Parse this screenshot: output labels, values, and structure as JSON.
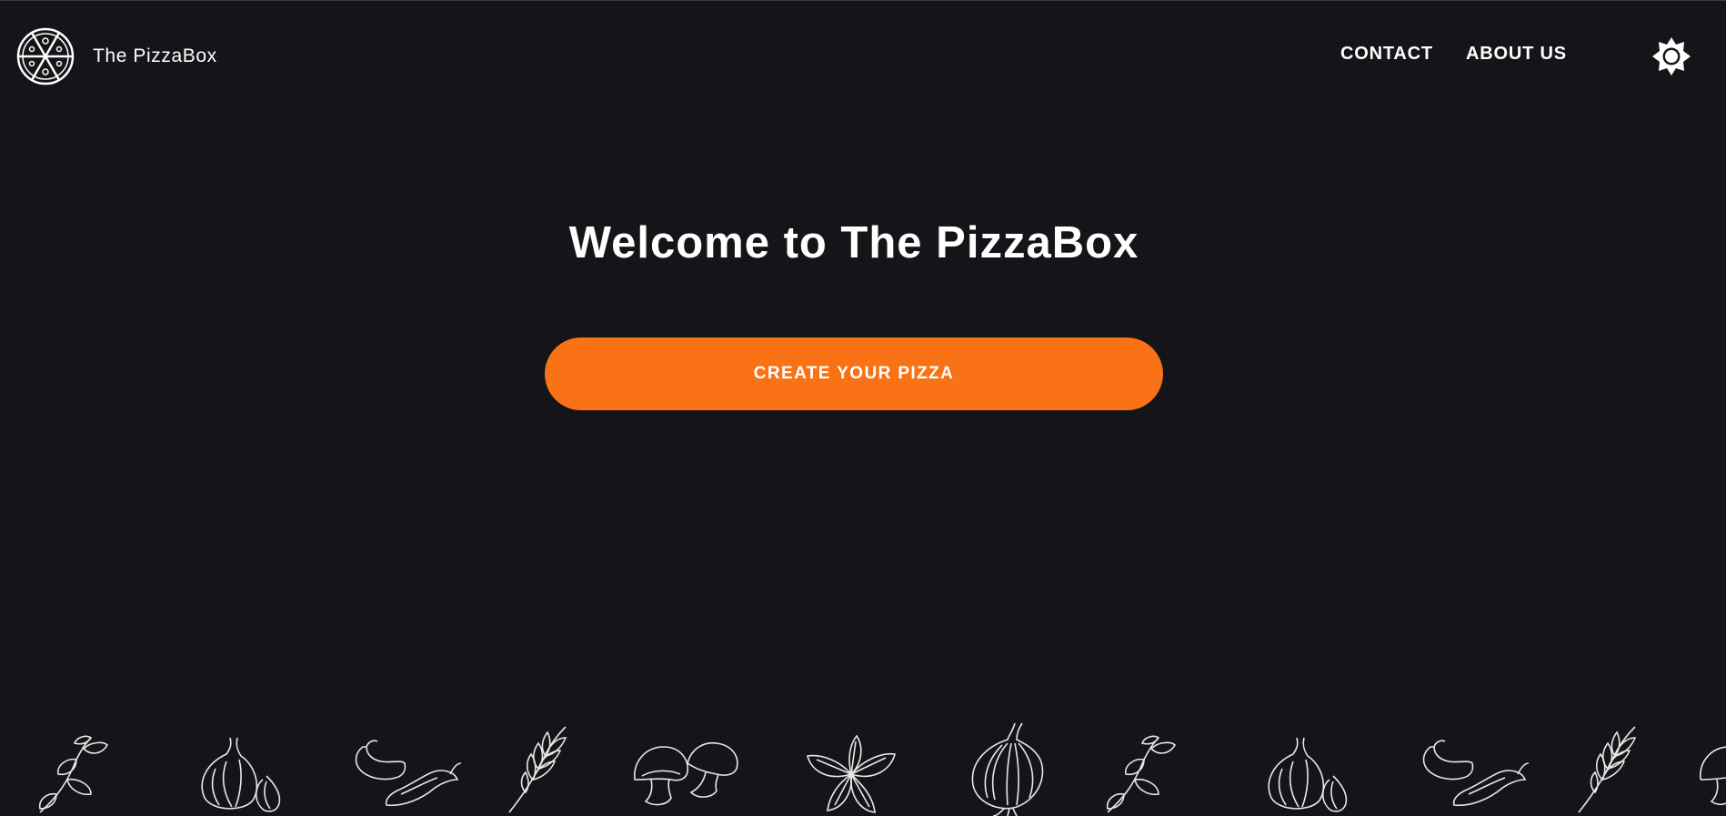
{
  "brand": {
    "name": "The PizzaBox",
    "logo_icon": "pizza-slices-icon"
  },
  "nav": {
    "contact_label": "CONTACT",
    "about_label": "ABOUT US",
    "theme_toggle_icon": "sun-icon"
  },
  "hero": {
    "title": "Welcome to The PizzaBox",
    "cta_label": "CREATE YOUR PIZZA"
  },
  "ingredients_strip": [
    "basil-sprig-icon",
    "garlic-icon",
    "chili-pepper-icon",
    "wheat-icon",
    "mushroom-icon",
    "basil-leaves-icon",
    "onion-icon",
    "basil-sprig-icon",
    "garlic-icon",
    "chili-pepper-icon",
    "wheat-icon",
    "mushroom-icon"
  ],
  "colors": {
    "background": "#141518",
    "accent": "#f97316",
    "text": "#ffffff"
  }
}
